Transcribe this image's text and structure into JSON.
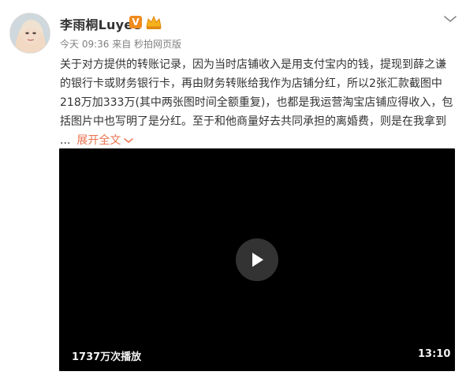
{
  "post": {
    "author_name": "李雨桐Luyee",
    "verified_badge": "V",
    "meta": "今天 09:36 来自 秒拍网页版",
    "text_lines": [
      "关于对方提供的转账记录，因为当时店铺收入是用支付宝内的钱，提现到薛之谦",
      "的银行卡或财务银行卡，再由财务转账给我作为店铺分红，所以2张汇款截图中",
      "218万加333万(其中两张图时间全额重复)，也都是我运营淘宝店铺应得收入，包",
      "括图片中也写明了是分红。至于和他商量好去共同承担的离婚费，则是在我拿到"
    ],
    "ellipsis": "...",
    "expand_label": "展开全文"
  },
  "video": {
    "views": "1737万次播放",
    "duration": "13:10"
  },
  "colors": {
    "name": "#333333",
    "meta": "#808080",
    "link": "#eb7350",
    "badge": "#f08a1c",
    "video_bg": "#000000"
  },
  "icons": {
    "verified": "verified-v-icon",
    "crown": "crown-icon",
    "menu": "chevron-down-icon",
    "expand": "chevron-down-icon",
    "play": "play-icon"
  }
}
